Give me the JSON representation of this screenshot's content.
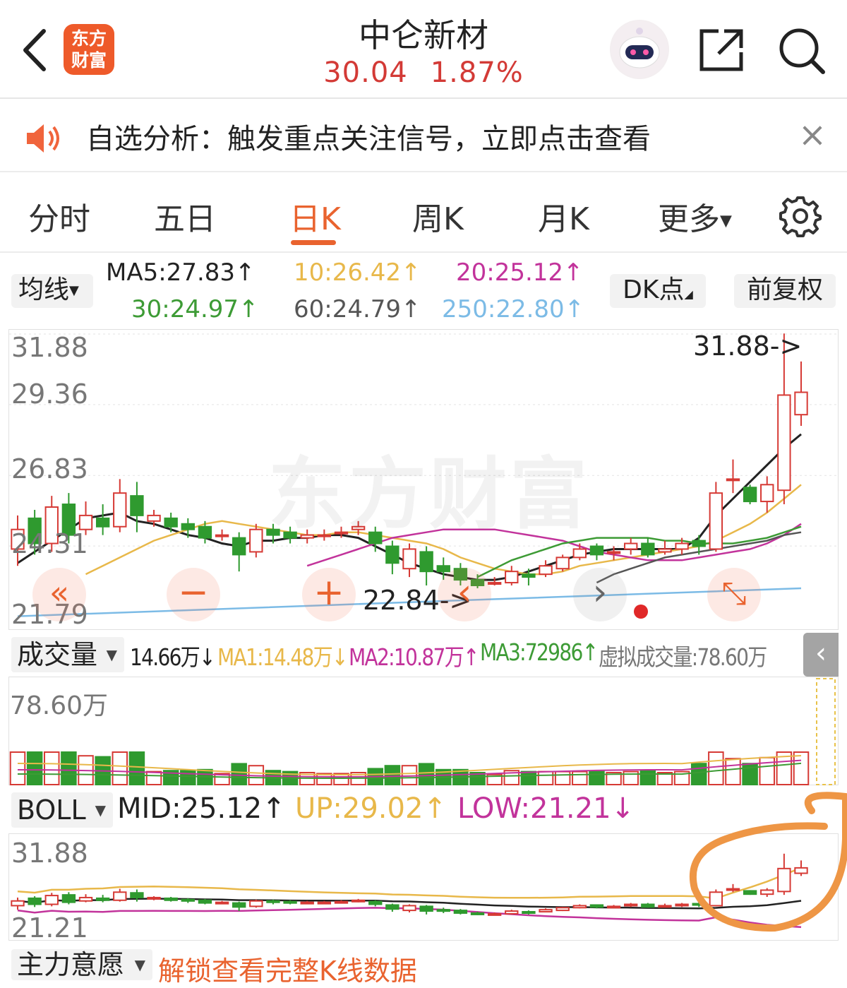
{
  "header": {
    "title": "中仑新材",
    "price": "30.04",
    "change_pct": "1.87%",
    "logo_line1": "东方",
    "logo_line2": "财富",
    "price_color": "#d33a36"
  },
  "notice": {
    "text": "自选分析：触发重点关注信号，立即点击查看",
    "close": "×"
  },
  "tabs": [
    "分时",
    "五日",
    "日K",
    "周K",
    "月K",
    "更多"
  ],
  "active_tab": "日K",
  "ma_bar": {
    "selector": "均线",
    "ma5": "MA5:27.83↑",
    "ma10": "10:26.42↑",
    "ma20": "20:25.12↑",
    "ma30": "30:24.97↑",
    "ma60": "60:24.79↑",
    "ma250": "250:22.80↑",
    "dk_button": "DK点",
    "fq_button": "前复权",
    "colors": {
      "ma5": "#222222",
      "ma10": "#e8b84a",
      "ma20": "#c2339b",
      "ma30": "#3d9b35",
      "ma60": "#555555",
      "ma250": "#7cbbe6"
    }
  },
  "main_chart": {
    "y_labels": [
      "31.88",
      "29.36",
      "26.83",
      "24.31",
      "21.79"
    ],
    "high_marker": "31.88->",
    "low_marker": "22.84->",
    "watermark": "东方财富",
    "controls": [
      "«",
      "−",
      "+",
      "‹",
      "›",
      "⤡"
    ]
  },
  "volume_bar": {
    "selector": "成交量",
    "vol": "14.66万↓",
    "ma1": "MA1:14.48万↓",
    "ma2": "MA2:10.87万↑",
    "ma3": "MA3:72986↑",
    "virtual": "虚拟成交量:78.60万",
    "y_label": "78.60万",
    "toggle": "‹"
  },
  "boll_bar": {
    "selector": "BOLL",
    "mid": "MID:25.12↑",
    "up": "UP:29.02↑",
    "low": "LOW:21.21↓",
    "y_top": "31.88",
    "y_bottom": "21.21"
  },
  "bottom_bar": {
    "selector": "主力意愿",
    "unlock": "解锁查看完整K线数据"
  },
  "chart_data": {
    "type": "candlestick",
    "y_range": [
      21.79,
      31.88
    ],
    "candles": [
      [
        24.2,
        24.9,
        23.6,
        25.4
      ],
      [
        25.3,
        24.4,
        24.0,
        25.6
      ],
      [
        24.4,
        25.7,
        24.1,
        26.1
      ],
      [
        25.8,
        24.7,
        24.4,
        26.2
      ],
      [
        24.9,
        25.4,
        24.7,
        25.9
      ],
      [
        25.3,
        25.0,
        24.7,
        25.8
      ],
      [
        25.0,
        26.2,
        24.8,
        26.7
      ],
      [
        26.1,
        25.4,
        24.8,
        26.6
      ],
      [
        25.2,
        25.4,
        25.0,
        25.6
      ],
      [
        25.3,
        25.0,
        24.8,
        25.5
      ],
      [
        25.1,
        24.9,
        24.6,
        25.3
      ],
      [
        25.0,
        24.6,
        24.4,
        25.2
      ],
      [
        24.7,
        24.7,
        24.5,
        24.9
      ],
      [
        24.6,
        24.0,
        23.4,
        24.8
      ],
      [
        24.1,
        24.9,
        23.9,
        25.1
      ],
      [
        24.9,
        24.7,
        24.4,
        25.1
      ],
      [
        24.8,
        24.6,
        24.4,
        25.0
      ],
      [
        24.6,
        24.7,
        24.4,
        24.9
      ],
      [
        24.7,
        24.7,
        24.5,
        24.9
      ],
      [
        24.8,
        24.8,
        24.6,
        25.0
      ],
      [
        24.9,
        25.0,
        24.7,
        25.2
      ],
      [
        24.8,
        24.4,
        24.1,
        25.0
      ],
      [
        24.3,
        23.7,
        23.3,
        24.5
      ],
      [
        23.5,
        24.2,
        23.2,
        24.4
      ],
      [
        24.1,
        23.4,
        22.9,
        24.3
      ],
      [
        23.6,
        23.4,
        23.1,
        23.9
      ],
      [
        23.5,
        23.1,
        22.9,
        23.7
      ],
      [
        23.1,
        22.9,
        22.8,
        23.3
      ],
      [
        23.0,
        23.0,
        22.9,
        23.2
      ],
      [
        23.0,
        23.4,
        22.9,
        23.6
      ],
      [
        23.3,
        23.2,
        22.9,
        23.5
      ],
      [
        23.3,
        23.6,
        23.2,
        23.8
      ],
      [
        23.5,
        23.9,
        23.4,
        24.0
      ],
      [
        23.9,
        24.2,
        23.8,
        24.4
      ],
      [
        24.3,
        24.0,
        23.8,
        24.4
      ],
      [
        24.1,
        24.1,
        23.8,
        24.3
      ],
      [
        24.2,
        24.4,
        24.0,
        24.6
      ],
      [
        24.4,
        24.0,
        23.9,
        24.6
      ],
      [
        24.1,
        24.2,
        24.0,
        24.5
      ],
      [
        24.2,
        24.4,
        24.0,
        24.6
      ],
      [
        24.5,
        24.3,
        24.0,
        24.7
      ],
      [
        24.2,
        26.2,
        24.1,
        26.6
      ],
      [
        26.7,
        26.7,
        26.2,
        27.4
      ],
      [
        26.4,
        25.9,
        25.8,
        26.5
      ],
      [
        25.9,
        26.5,
        25.5,
        26.8
      ],
      [
        26.3,
        29.7,
        25.8,
        31.9
      ],
      [
        29.0,
        29.8,
        28.6,
        30.9
      ]
    ],
    "volume_y_max": "78.60万",
    "series": [
      {
        "name": "MA5",
        "values": [
          23.7,
          24.1,
          24.5,
          24.9,
          25.3,
          25.4,
          25.5,
          25.2,
          25.1,
          24.9,
          24.7,
          24.6,
          24.4,
          24.3,
          24.5,
          24.5,
          24.6,
          24.6,
          24.7,
          24.7,
          24.6,
          24.3,
          24.0,
          23.7,
          23.5,
          23.3,
          23.2,
          23.1,
          23.1,
          23.2,
          23.4,
          23.6,
          23.8,
          24.0,
          24.1,
          24.2,
          24.2,
          24.2,
          24.2,
          24.2,
          24.6,
          25.4,
          26.0,
          26.6,
          27.2,
          27.8,
          28.3
        ]
      },
      {
        "name": "MA10",
        "values": [
          23.3,
          23.6,
          23.9,
          24.2,
          24.5,
          24.7,
          24.9,
          25.1,
          25.2,
          25.1,
          25.0,
          24.9,
          24.8,
          24.7,
          24.7,
          24.8,
          24.8,
          24.7,
          24.6,
          24.5,
          24.4,
          24.2,
          23.9,
          23.7,
          23.5,
          23.4,
          23.3,
          23.3,
          23.4,
          23.6,
          23.7,
          23.8,
          23.9,
          24.0,
          24.1,
          24.2,
          24.3,
          24.5,
          24.8,
          25.1,
          25.5,
          26.0,
          26.5
        ]
      },
      {
        "name": "MA20",
        "values": [
          23.6,
          23.8,
          24.0,
          24.2,
          24.4,
          24.6,
          24.7,
          24.8,
          24.9,
          24.9,
          24.9,
          24.9,
          24.8,
          24.7,
          24.6,
          24.5,
          24.3,
          24.1,
          24.0,
          23.9,
          23.8,
          23.8,
          23.8,
          23.9,
          24.0,
          24.1,
          24.2,
          24.4,
          24.7,
          25.1
        ]
      },
      {
        "name": "MA30",
        "values": [
          23.2,
          23.5,
          23.8,
          24.0,
          24.2,
          24.4,
          24.5,
          24.6,
          24.6,
          24.6,
          24.6,
          24.5,
          24.5,
          24.4,
          24.4,
          24.4,
          24.5,
          24.6,
          24.8,
          25.0
        ]
      },
      {
        "name": "MA60",
        "values": [
          23.0,
          23.3,
          23.5,
          23.7,
          23.9,
          24.0,
          24.1,
          24.2,
          24.3,
          24.4,
          24.5,
          24.7,
          24.8
        ]
      },
      {
        "name": "MA250",
        "values": [
          21.8,
          22.0,
          22.2,
          22.4,
          22.6,
          22.8
        ]
      }
    ]
  },
  "icons": [
    "back-chevron-icon",
    "share-icon",
    "search-icon",
    "speaker-icon",
    "gear-icon",
    "robot-avatar-icon"
  ]
}
